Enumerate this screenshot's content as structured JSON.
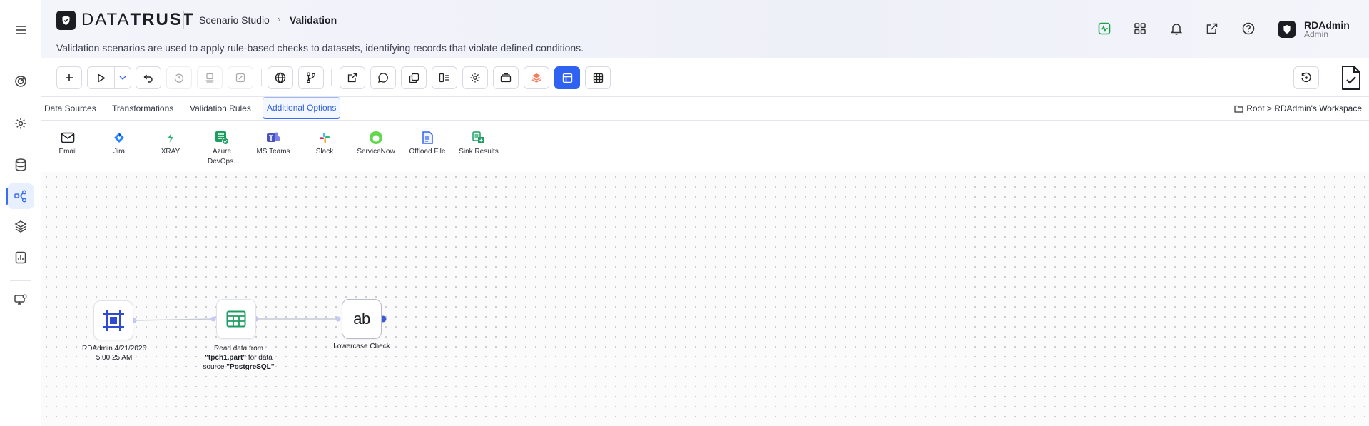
{
  "header": {
    "logo_text_light": "DATA",
    "logo_text_bold": "TRUST",
    "breadcrumb_parent": "Scenario Studio",
    "breadcrumb_current": "Validation",
    "subtitle": "Validation scenarios are used to apply rule-based checks to datasets, identifying records that violate defined conditions.",
    "icons": [
      "activity-icon",
      "apps-grid-icon",
      "bell-icon",
      "external-link-icon",
      "help-icon"
    ],
    "user": {
      "name": "RDAdmin",
      "role": "Admin"
    }
  },
  "sidebar": {
    "items": [
      "menu-icon",
      "target-icon",
      "settings-icon",
      "database-icon",
      "workflow-icon",
      "layers-icon",
      "reports-icon",
      "monitor-settings-icon"
    ],
    "active": "workflow-icon"
  },
  "tabs": [
    {
      "label": "Data Sources"
    },
    {
      "label": "Transformations"
    },
    {
      "label": "Validation Rules"
    },
    {
      "label": "Additional Options",
      "active": true
    }
  ],
  "workspace_path": "Root > RDAdmin's Workspace",
  "options": [
    {
      "label": "Email",
      "icon": "mail-icon"
    },
    {
      "label": "Jira",
      "icon": "jira-icon"
    },
    {
      "label": "XRAY",
      "icon": "xray-icon"
    },
    {
      "label": "Azure DevOps...",
      "icon": "azure-devops-icon"
    },
    {
      "label": "MS Teams",
      "icon": "ms-teams-icon"
    },
    {
      "label": "Slack",
      "icon": "slack-icon"
    },
    {
      "label": "ServiceNow",
      "icon": "servicenow-icon"
    },
    {
      "label": "Offload File",
      "icon": "offload-file-icon"
    },
    {
      "label": "Sink Results",
      "icon": "sink-results-icon"
    }
  ],
  "nodes": {
    "start": {
      "label": "RDAdmin 4/21/2026 5:00:25 AM"
    },
    "read": {
      "prefix": "Read data from ",
      "table": "\"tpch1.part\"",
      "middle": " for data source ",
      "source": "\"PostgreSQL\""
    },
    "check": {
      "icon_text": "ab",
      "label": "Lowercase Check"
    }
  },
  "colors": {
    "accent": "#2f62f0",
    "sidebar_active": "#e8efff",
    "brand_dark": "#1c1d22"
  }
}
